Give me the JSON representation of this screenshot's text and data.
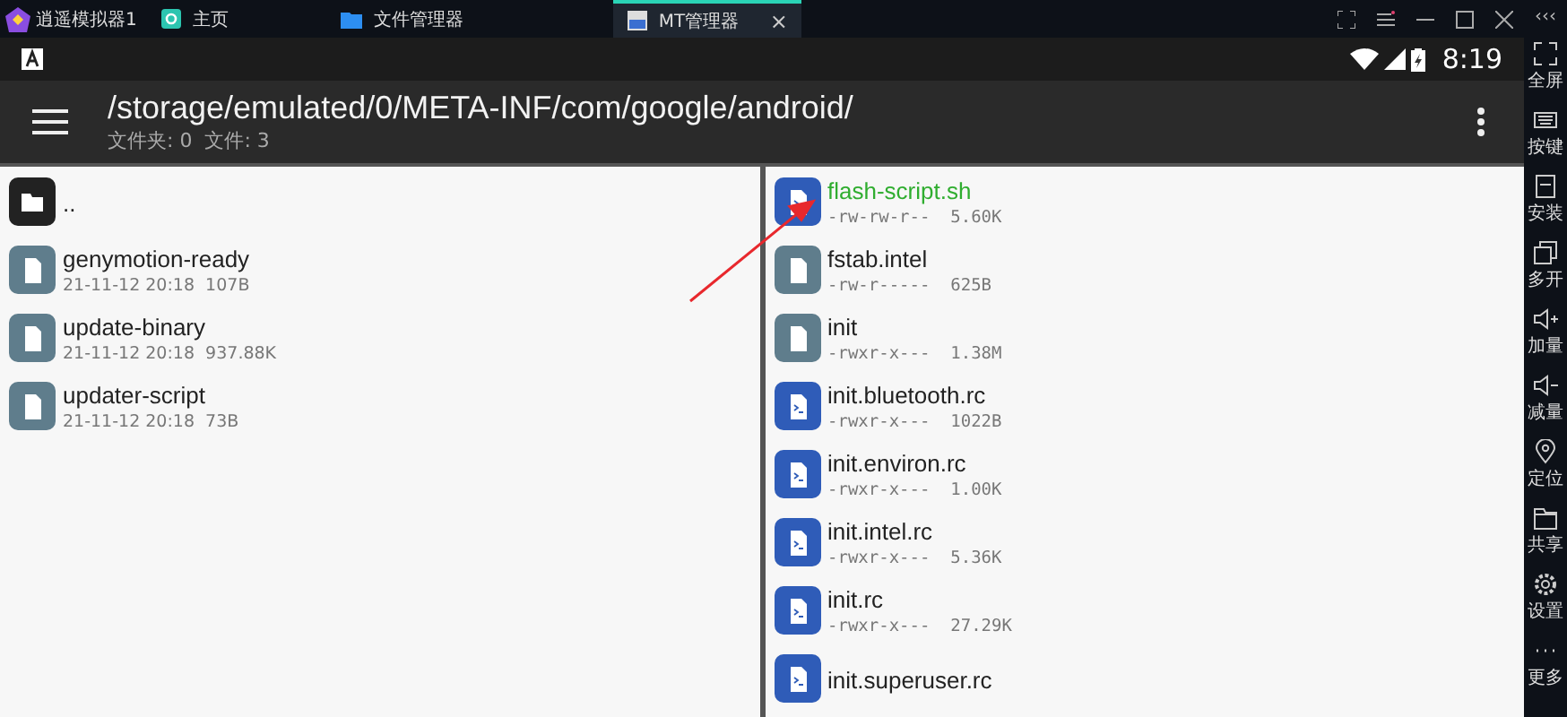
{
  "emulator": {
    "app_name": "逍遥模拟器1",
    "tabs": [
      {
        "label": "主页",
        "kind": "home",
        "selected": false
      },
      {
        "label": "文件管理器",
        "kind": "folder",
        "selected": false
      },
      {
        "label": "MT管理器",
        "kind": "mt",
        "selected": true,
        "close": "×"
      }
    ],
    "collapse": "‹‹‹"
  },
  "status_bar": {
    "time": "8:19"
  },
  "toolbar": {
    "path": "/storage/emulated/0/META-INF/com/google/android/",
    "summary": "文件夹: 0  文件: 3"
  },
  "left_panel": {
    "items": [
      {
        "kind": "folder",
        "name": "..",
        "marked": false
      },
      {
        "kind": "file",
        "name": "genymotion-ready",
        "meta": "21-11-12 20:18  107B",
        "marked": false
      },
      {
        "kind": "file",
        "name": "update-binary",
        "meta": "21-11-12 20:18  937.88K",
        "marked": false
      },
      {
        "kind": "file",
        "name": "updater-script",
        "meta": "21-11-12 20:18  73B",
        "marked": false
      }
    ]
  },
  "right_panel": {
    "items": [
      {
        "kind": "script",
        "name": "flash-script.sh",
        "meta": "-rw-rw-r--  5.60K",
        "marked": true
      },
      {
        "kind": "file",
        "name": "fstab.intel",
        "meta": "-rw-r-----  625B",
        "marked": false
      },
      {
        "kind": "file",
        "name": "init",
        "meta": "-rwxr-x---  1.38M",
        "marked": false
      },
      {
        "kind": "script",
        "name": "init.bluetooth.rc",
        "meta": "-rwxr-x---  1022B",
        "marked": false
      },
      {
        "kind": "script",
        "name": "init.environ.rc",
        "meta": "-rwxr-x---  1.00K",
        "marked": false
      },
      {
        "kind": "script",
        "name": "init.intel.rc",
        "meta": "-rwxr-x---  5.36K",
        "marked": false
      },
      {
        "kind": "script",
        "name": "init.rc",
        "meta": "-rwxr-x---  27.29K",
        "marked": false
      },
      {
        "kind": "script",
        "name": "init.superuser.rc",
        "marked": false
      }
    ]
  },
  "side_toolbar": [
    {
      "kind": "fullscreen",
      "label": "全屏"
    },
    {
      "kind": "keyboard",
      "label": "按键"
    },
    {
      "kind": "apk",
      "label": "安装"
    },
    {
      "kind": "multi",
      "label": "多开"
    },
    {
      "kind": "volup",
      "label": "加量"
    },
    {
      "kind": "voldown",
      "label": "减量"
    },
    {
      "kind": "location",
      "label": "定位"
    },
    {
      "kind": "share",
      "label": "共享"
    },
    {
      "kind": "settings",
      "label": "设置"
    },
    {
      "kind": "more",
      "label": "更多"
    }
  ]
}
